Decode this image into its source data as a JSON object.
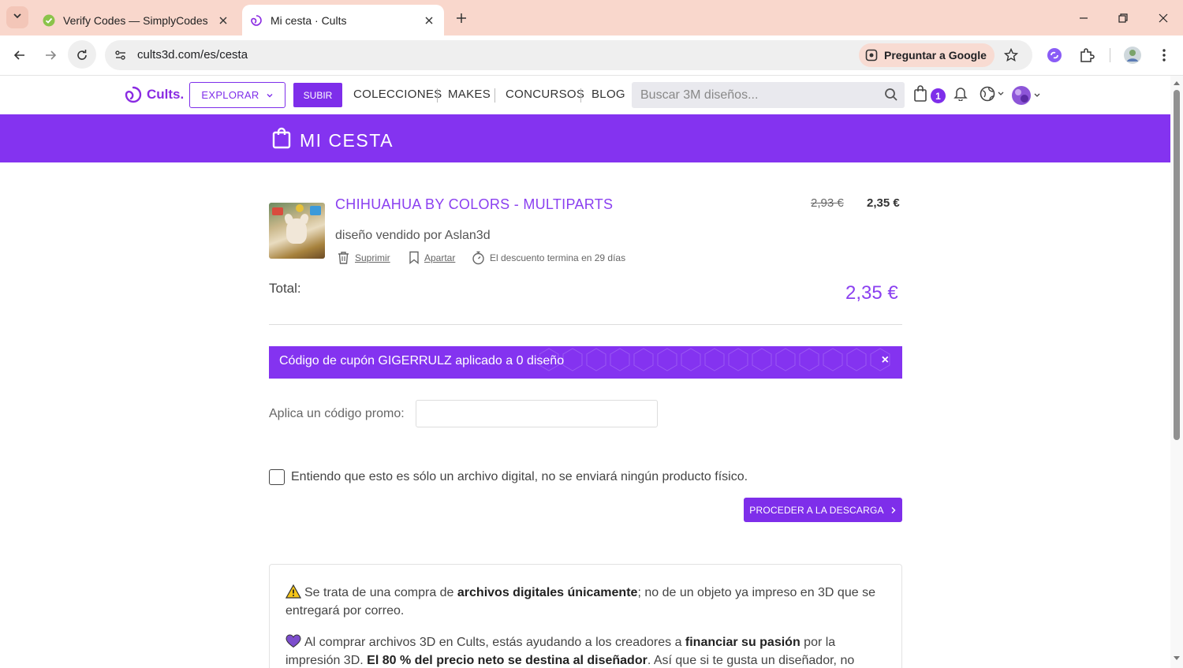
{
  "browser": {
    "tabs": [
      {
        "title": "Verify Codes — SimplyCodes",
        "active": false
      },
      {
        "title": "Mi cesta · Cults",
        "active": true
      }
    ],
    "url": "cults3d.com/es/cesta",
    "ask_google": "Preguntar a Google"
  },
  "header": {
    "logo": "Cults.",
    "explore": "EXPLORAR",
    "upload": "SUBIR",
    "nav": [
      "COLECCIONES",
      "MAKES",
      "CONCURSOS",
      "BLOG"
    ],
    "search_placeholder": "Buscar 3M diseños...",
    "cart_count": "1"
  },
  "banner": {
    "title": "MI CESTA"
  },
  "cart": {
    "item": {
      "title": "CHIHUAHUA BY COLORS - MULTIPARTS",
      "old_price": "2,93 €",
      "price": "2,35 €",
      "seller": "diseño vendido por Aslan3d",
      "delete": "Suprimir",
      "save": "Apartar",
      "discount": "El descuento termina en 29 días"
    },
    "total_label": "Total:",
    "total_value": "2,35 €",
    "coupon_message": "Código de cupón GIGERRULZ aplicado a 0 diseño",
    "coupon_close": "×",
    "promo_label": "Aplica un código promo:",
    "promo_value": "",
    "checkbox_label": "Entiendo que esto es sólo un archivo digital, no se enviará ningún producto físico.",
    "checkbox_checked": false,
    "proceed": "PROCEDER A LA DESCARGA"
  },
  "info": {
    "p1_pre": "Se trata de una compra de ",
    "p1_bold": "archivos digitales únicamente",
    "p1_post": "; no de un objeto ya impreso en 3D que se entregará por correo.",
    "p2_pre": "Al comprar archivos 3D en Cults, estás ayudando a los creadores a ",
    "p2_bold1": "financiar su pasión",
    "p2_mid": " por la impresión 3D. ",
    "p2_bold2": "El 80 % del precio neto se destina al diseñador",
    "p2_post": ". Así que si te gusta un diseñador, no dudes en comprar"
  },
  "colors": {
    "brand": "#8433f0",
    "tabbar": "#f9d7cc"
  }
}
